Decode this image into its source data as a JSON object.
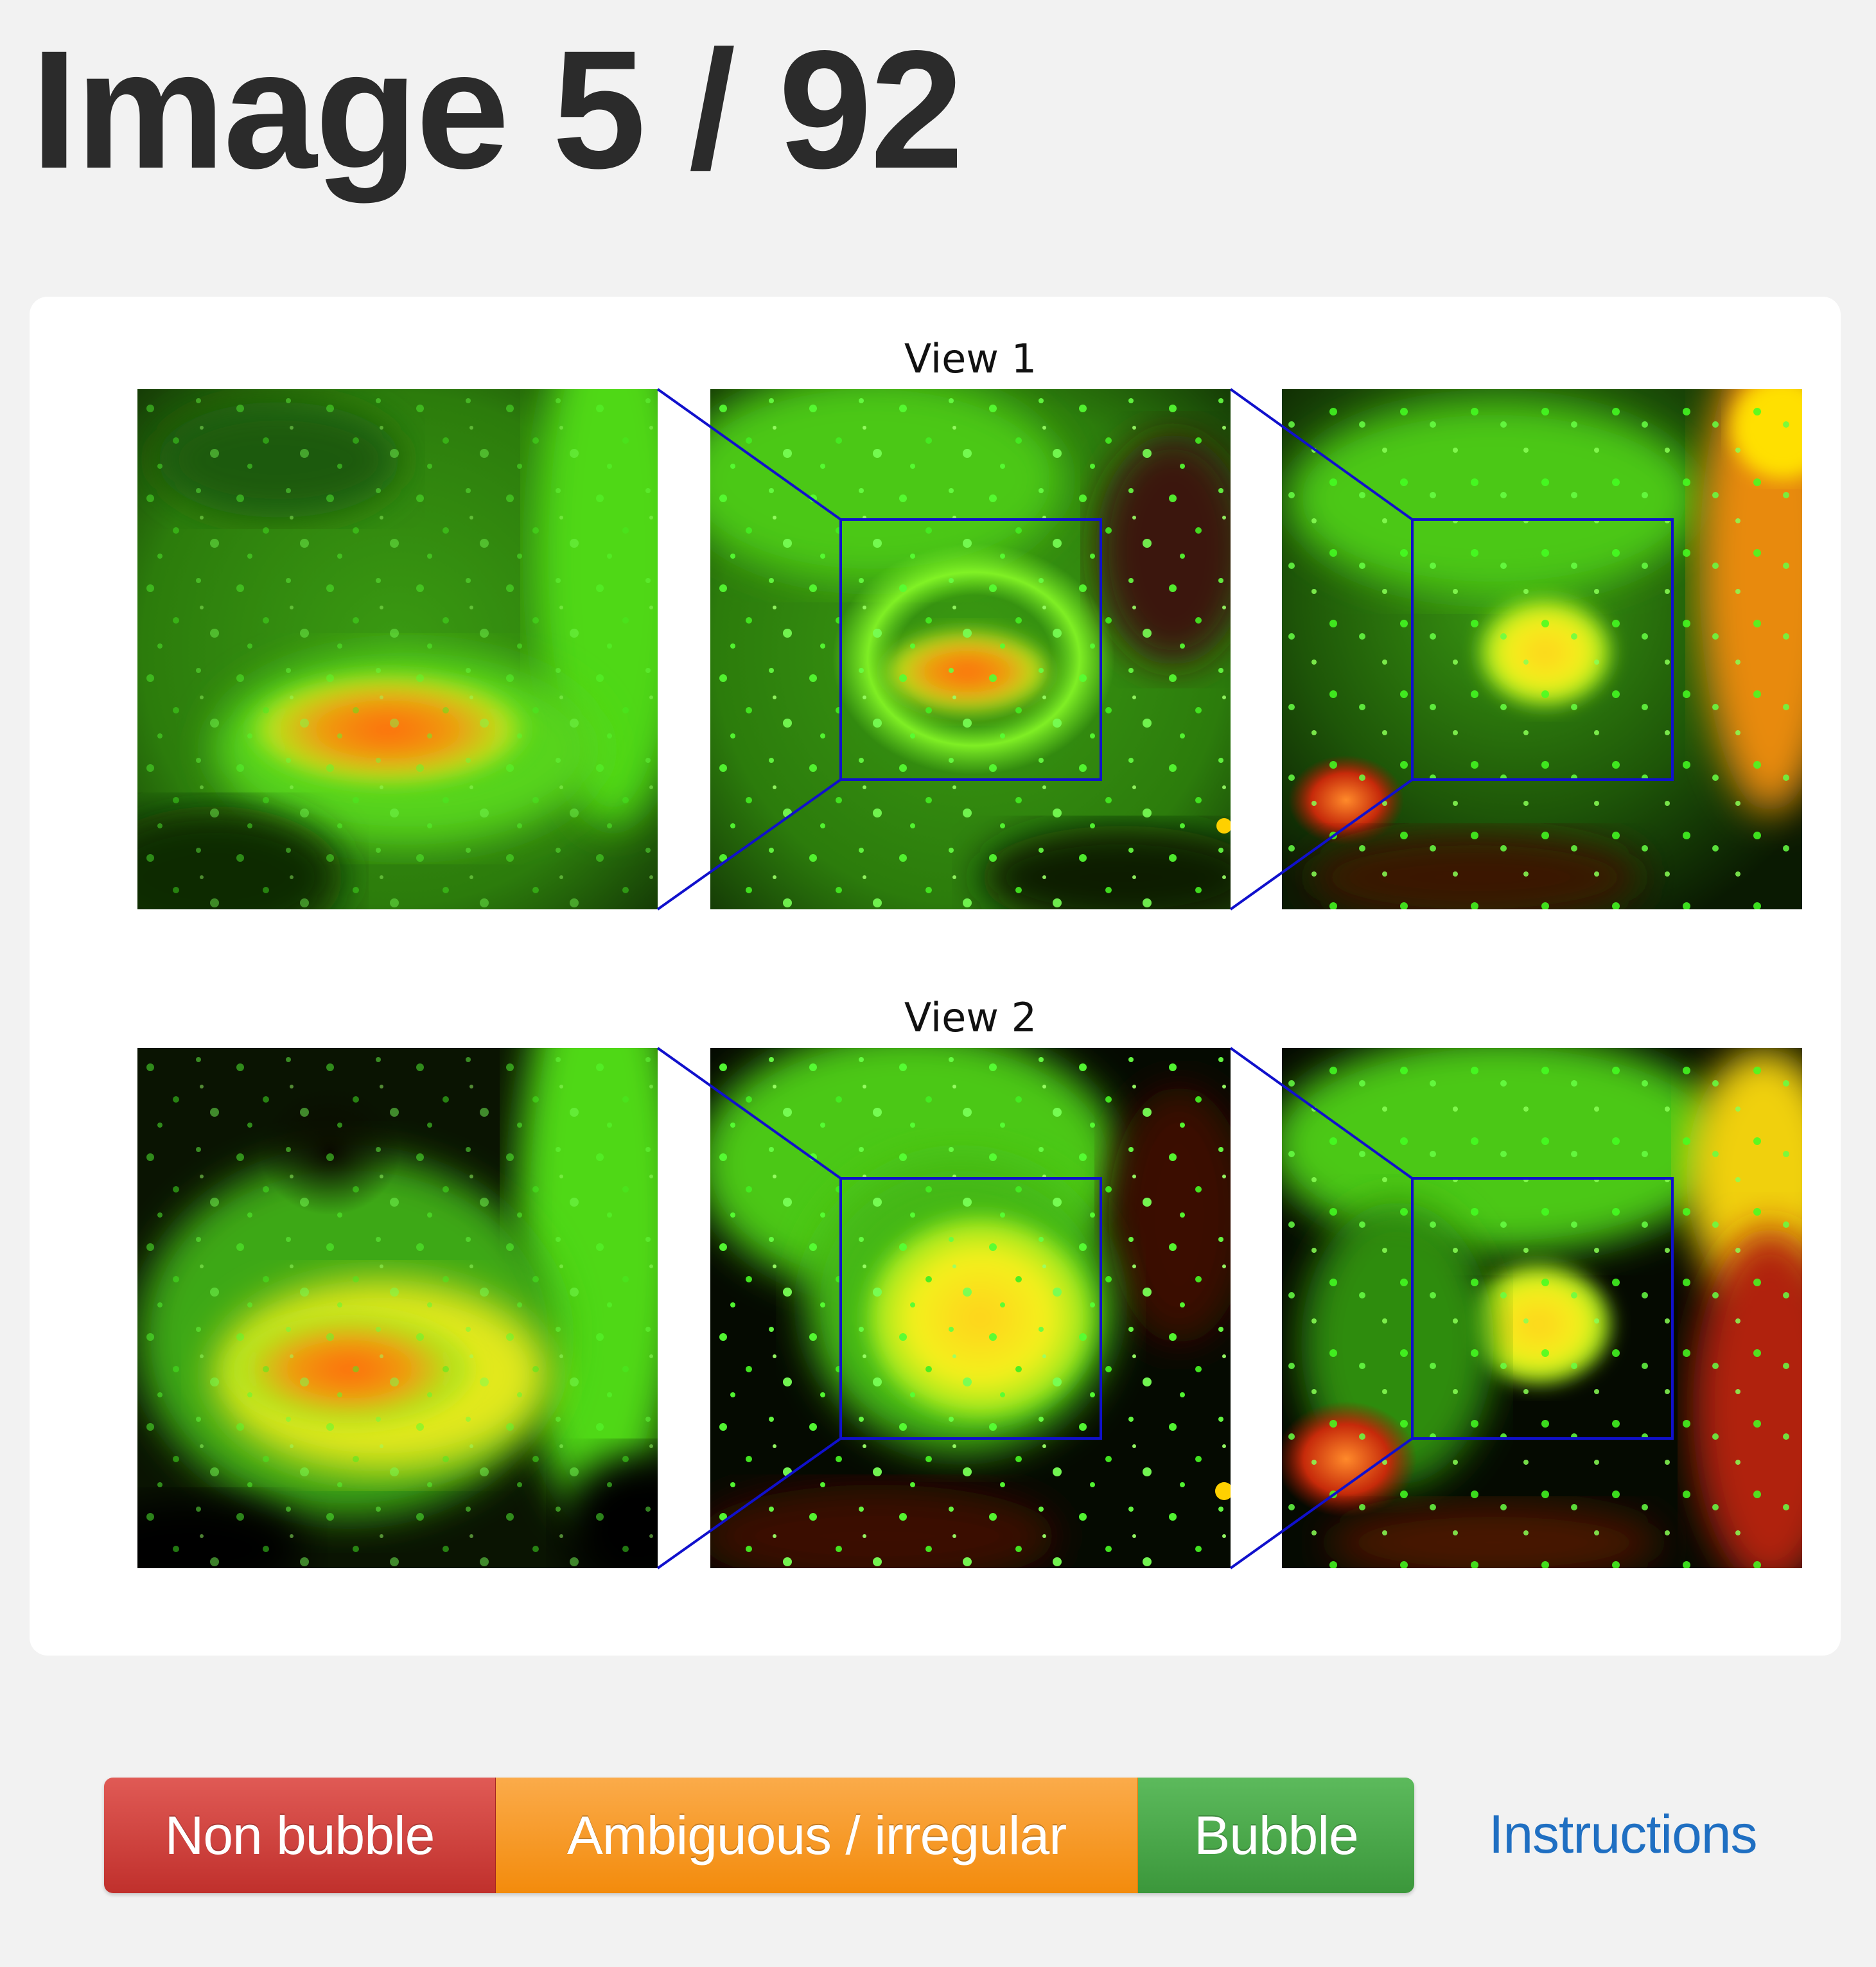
{
  "header": {
    "title": "Image 5 / 92"
  },
  "views": [
    {
      "label": "View 1"
    },
    {
      "label": "View 2"
    }
  ],
  "actions": {
    "non_bubble": {
      "label": "Non bubble",
      "color": "#d9534f"
    },
    "ambiguous": {
      "label": "Ambiguous / irregular",
      "color": "#f0ad4e"
    },
    "bubble": {
      "label": "Bubble",
      "color": "#5cb85c"
    }
  },
  "links": {
    "instructions": "Instructions"
  },
  "colors": {
    "zoom_box": "#1010cc",
    "background": "#f2f2f2",
    "panel": "#ffffff"
  }
}
